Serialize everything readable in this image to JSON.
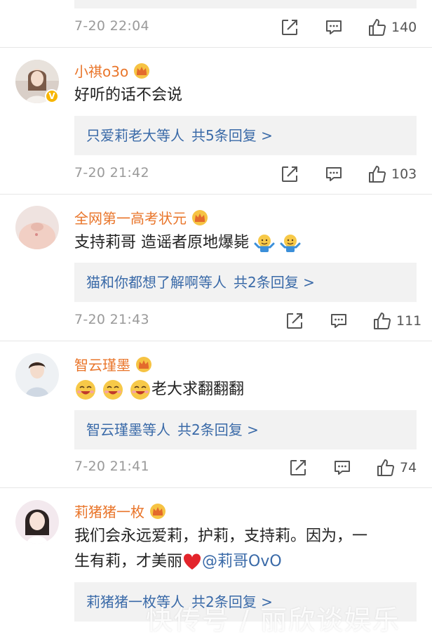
{
  "comments": [
    {
      "meta": {
        "time": "7-20 22:04",
        "likes": "140"
      }
    },
    {
      "username": "小祺o3o",
      "content": "好听的话不会说",
      "replies": {
        "names": "只爱莉老大等人",
        "count_text": "共5条回复 >"
      },
      "meta": {
        "time": "7-20 21:42",
        "likes": "103"
      }
    },
    {
      "username": "全网第一高考状元",
      "content": "支持莉哥 造谣者原地爆毙",
      "replies": {
        "names": "猫和你都想了解啊等人",
        "count_text": "共2条回复 >"
      },
      "meta": {
        "time": "7-20 21:43",
        "likes": "111"
      }
    },
    {
      "username": "智云瑾墨",
      "content": "老大求翻翻翻",
      "replies": {
        "names": "智云瑾墨等人",
        "count_text": "共2条回复 >"
      },
      "meta": {
        "time": "7-20 21:41",
        "likes": "74"
      }
    },
    {
      "username": "莉猪猪一枚",
      "content_line1": "我们会永远爱莉，护莉，支持莉。因为，一",
      "content_line2": "生有莉，才美丽",
      "mention": "@莉哥OvO",
      "replies": {
        "names": "莉猪猪一枚等人",
        "count_text": "共2条回复 >"
      }
    }
  ],
  "watermark": "快传号 / 丽欣谈娱乐",
  "colors": {
    "username": "#e9752a",
    "link": "#3a6aa8",
    "time": "#9a9a9a",
    "reply_bg": "#f2f2f2"
  },
  "icons": [
    "share-icon",
    "comment-icon",
    "like-icon",
    "crown-badge-icon",
    "verified-badge-icon"
  ]
}
